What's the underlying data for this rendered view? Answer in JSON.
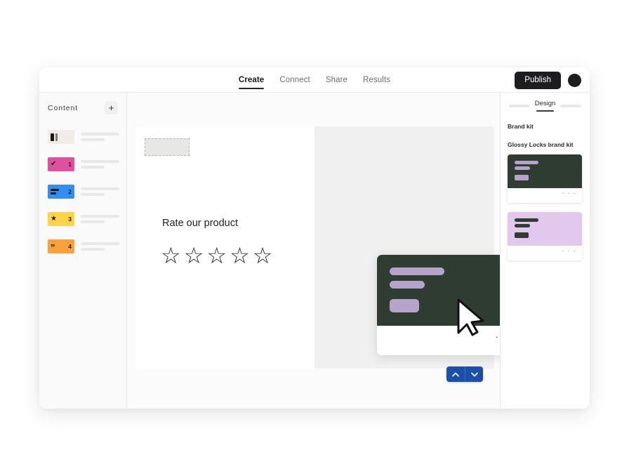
{
  "topbar": {
    "tabs": [
      {
        "label": "Create",
        "active": true
      },
      {
        "label": "Connect",
        "active": false
      },
      {
        "label": "Share",
        "active": false
      },
      {
        "label": "Results",
        "active": false
      }
    ],
    "publish_label": "Publish",
    "avatar_icon": "user-avatar-icon"
  },
  "sidebar": {
    "title": "Content",
    "add_label": "+",
    "items": [
      {
        "number": "",
        "icon": "slide-layout-icon",
        "color": "#f0ece6"
      },
      {
        "number": "1",
        "icon": "check-icon",
        "glyph": "✔",
        "color": "#e0509e"
      },
      {
        "number": "2",
        "icon": "multiple-choice-icon",
        "color": "#2f8ff5"
      },
      {
        "number": "3",
        "icon": "star-icon",
        "glyph": "★",
        "color": "#fcd34a"
      },
      {
        "number": "4",
        "icon": "quote-icon",
        "glyph": "”",
        "color": "#f9a13a"
      }
    ]
  },
  "canvas": {
    "question_text": "Rate our product",
    "stars": [
      "☆",
      "☆",
      "☆",
      "☆",
      "☆"
    ],
    "placeholder_box_name": "image-placeholder",
    "overlay_card": {
      "dots": "· · ·",
      "art_color": "#2e3c31",
      "bar_color": "#b6a3cc"
    },
    "nav": {
      "up_icon": "chevron-up-icon",
      "down_icon": "chevron-down-icon",
      "color": "#1b4fa8"
    },
    "cursor_icon": "mouse-pointer-icon"
  },
  "design_panel": {
    "tab_label": "Design",
    "brand_kit_label": "Brand kit",
    "kit_name": "Glossy Locks brand kit",
    "themes": [
      {
        "name": "dark-green-theme",
        "bg": "#2e3c31",
        "accent": "#b6a3cc",
        "dots": "· · ·"
      },
      {
        "name": "lilac-theme",
        "bg": "#e2c8ed",
        "accent": "#2e3c31",
        "dots": "· · ·"
      }
    ]
  }
}
